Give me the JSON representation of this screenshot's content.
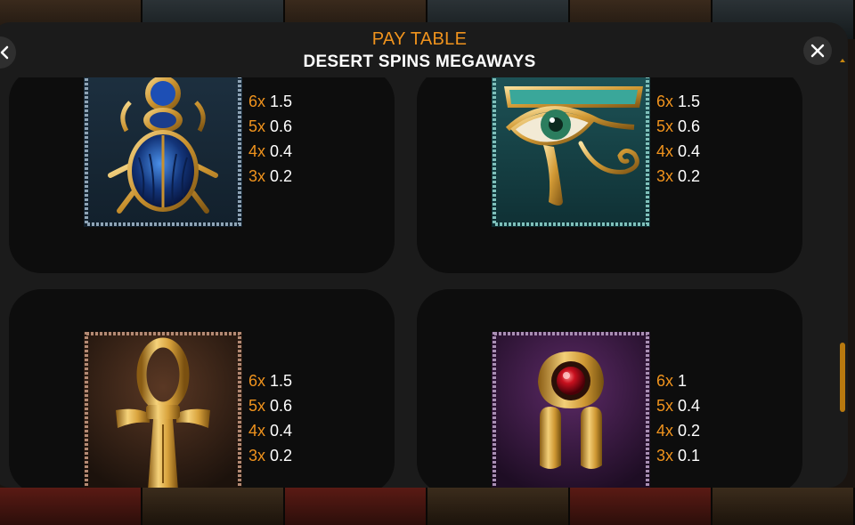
{
  "header": {
    "title": "PAY TABLE",
    "subtitle": "DESERT SPINS MEGAWAYS"
  },
  "colors": {
    "accent": "#f0931d",
    "panel": "#1b1b1b",
    "card": "#0d0d0d"
  },
  "symbols": [
    {
      "name": "blue-scarab",
      "icon": "scarab-icon",
      "pays": [
        {
          "mult": "6x",
          "value": "1.5"
        },
        {
          "mult": "5x",
          "value": "0.6"
        },
        {
          "mult": "4x",
          "value": "0.4"
        },
        {
          "mult": "3x",
          "value": "0.2"
        }
      ]
    },
    {
      "name": "eye-of-horus",
      "icon": "eye-of-horus-icon",
      "pays": [
        {
          "mult": "6x",
          "value": "1.5"
        },
        {
          "mult": "5x",
          "value": "0.6"
        },
        {
          "mult": "4x",
          "value": "0.4"
        },
        {
          "mult": "3x",
          "value": "0.2"
        }
      ]
    },
    {
      "name": "golden-ankh",
      "icon": "ankh-icon",
      "pays": [
        {
          "mult": "6x",
          "value": "1.5"
        },
        {
          "mult": "5x",
          "value": "0.6"
        },
        {
          "mult": "4x",
          "value": "0.4"
        },
        {
          "mult": "3x",
          "value": "0.2"
        }
      ]
    },
    {
      "name": "ruby-amulet",
      "icon": "amulet-icon",
      "pays": [
        {
          "mult": "6x",
          "value": "1"
        },
        {
          "mult": "5x",
          "value": "0.4"
        },
        {
          "mult": "4x",
          "value": "0.2"
        },
        {
          "mult": "3x",
          "value": "0.1"
        }
      ]
    }
  ]
}
